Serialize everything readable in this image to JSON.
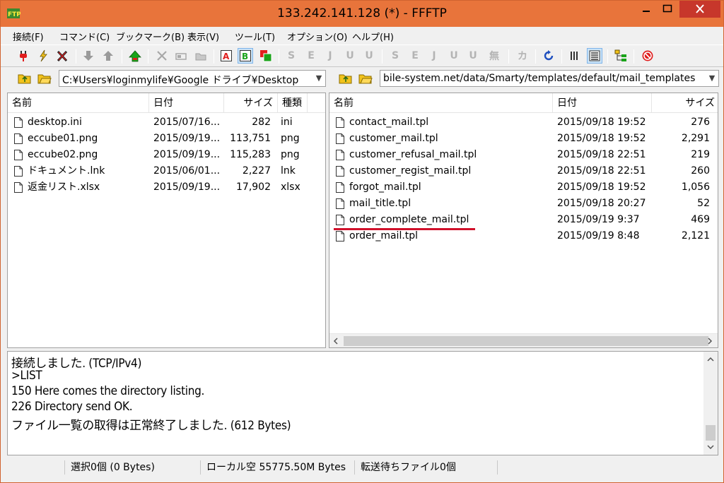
{
  "window": {
    "title": "133.242.141.128 (*) - FFFTP"
  },
  "menu": [
    "接続(F)",
    "コマンド(C)",
    "ブックマーク(B)",
    "表示(V)",
    "ツール(T)",
    "オプション(O)",
    "ヘルプ(H)"
  ],
  "toolbar": {
    "mode_a": "A",
    "mode_b": "B",
    "enc_s1": "S",
    "enc_e1": "E",
    "enc_j1": "J",
    "enc_u1": "U",
    "enc_u2": "U",
    "enc_s2": "S",
    "enc_e2": "E",
    "enc_j2": "J",
    "enc_u3": "U",
    "enc_u4": "U",
    "enc_none": "無",
    "kana": "カ"
  },
  "local": {
    "path": "C:¥Users¥loginmylife¥Google ドライブ¥Desktop",
    "columns": [
      "名前",
      "日付",
      "サイズ",
      "種類"
    ],
    "files": [
      {
        "name": "desktop.ini",
        "date": "2015/07/16...",
        "size": "282",
        "type": "ini"
      },
      {
        "name": "eccube01.png",
        "date": "2015/09/19...",
        "size": "113,751",
        "type": "png"
      },
      {
        "name": "eccube02.png",
        "date": "2015/09/19...",
        "size": "115,283",
        "type": "png"
      },
      {
        "name": "ドキュメント.lnk",
        "date": "2015/06/01...",
        "size": "2,227",
        "type": "lnk"
      },
      {
        "name": "返金リスト.xlsx",
        "date": "2015/09/19...",
        "size": "17,902",
        "type": "xlsx"
      }
    ]
  },
  "remote": {
    "path": "bile-system.net/data/Smarty/templates/default/mail_templates",
    "columns": [
      "名前",
      "日付",
      "サイズ"
    ],
    "files": [
      {
        "name": "contact_mail.tpl",
        "date": "2015/09/18 19:52",
        "size": "276"
      },
      {
        "name": "customer_mail.tpl",
        "date": "2015/09/18 19:52",
        "size": "2,291"
      },
      {
        "name": "customer_refusal_mail.tpl",
        "date": "2015/09/18 22:51",
        "size": "219"
      },
      {
        "name": "customer_regist_mail.tpl",
        "date": "2015/09/18 22:51",
        "size": "260"
      },
      {
        "name": "forgot_mail.tpl",
        "date": "2015/09/18 19:52",
        "size": "1,056"
      },
      {
        "name": "mail_title.tpl",
        "date": "2015/09/18 20:27",
        "size": "52"
      },
      {
        "name": "order_complete_mail.tpl",
        "date": "2015/09/19  9:37",
        "size": "469"
      },
      {
        "name": "order_mail.tpl",
        "date": "2015/09/19  8:48",
        "size": "2,121"
      }
    ],
    "highlighted": "order_complete_mail.tpl"
  },
  "log": [
    "接続しました. (TCP/IPv4)",
    ">LIST",
    "150 Here comes the directory listing.",
    "226 Directory send OK.",
    "ファイル一覧の取得は正常終了しました. (612 Bytes)"
  ],
  "status": {
    "selection": "選択0個 (0 Bytes)",
    "local_free": "ローカル空 55775.50M Bytes",
    "queue": "転送待ちファイル0個"
  },
  "colors": {
    "titlebar": "#e8743b",
    "close": "#c7372b",
    "highlight_underline": "#d0102a"
  }
}
